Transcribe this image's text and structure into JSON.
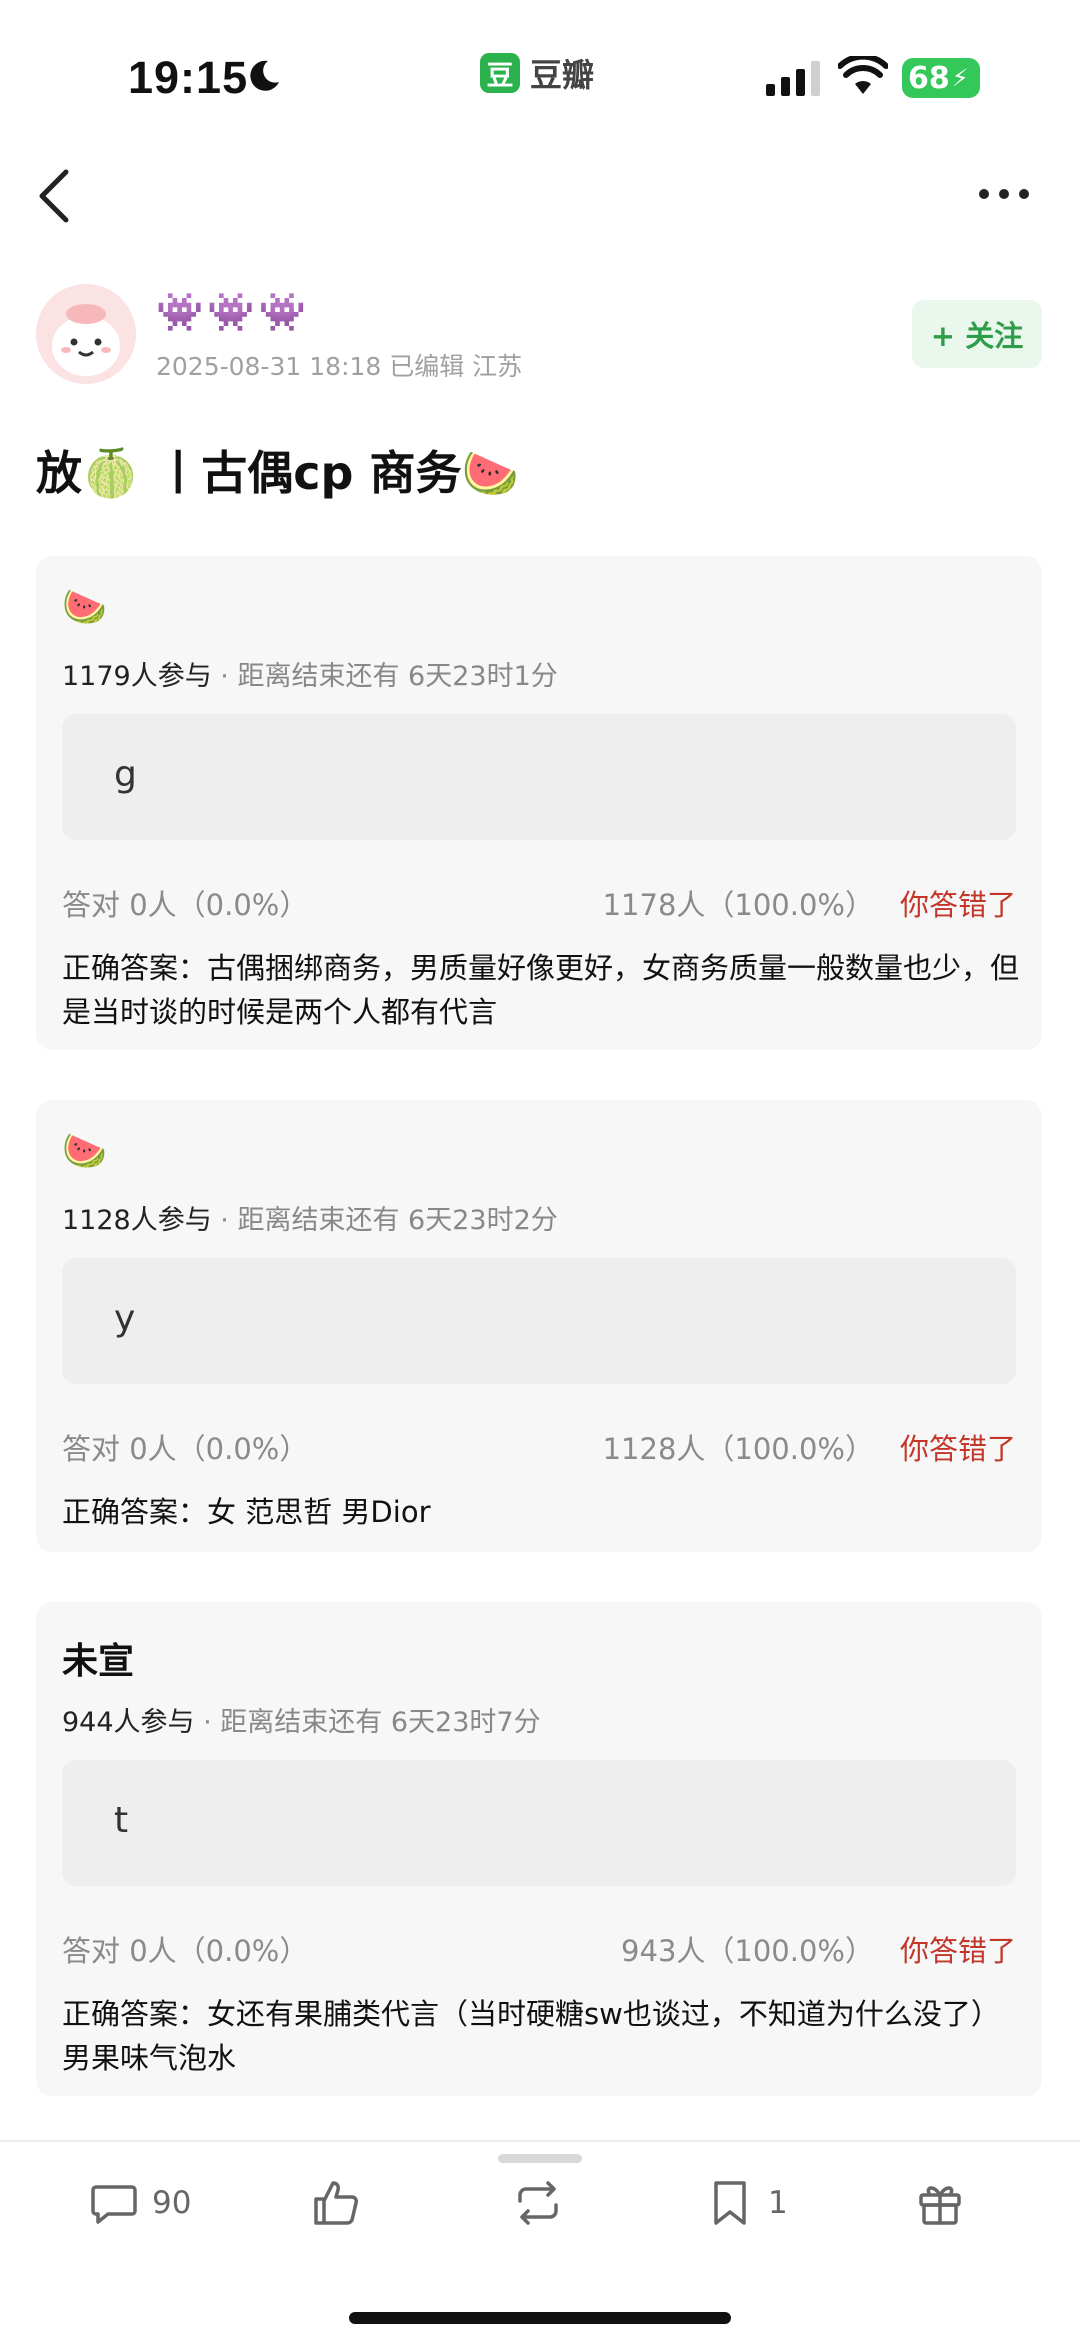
{
  "status_bar": {
    "time": "19:15",
    "app_name": "豆瓣",
    "app_logo_text": "豆",
    "battery": "68"
  },
  "post": {
    "author_name": "👾👾👾",
    "meta": "2025-08-31 18:18  已编辑  江苏",
    "follow_label": "+ 关注",
    "title": "放🍈 丨古偶cp 商务🍉"
  },
  "polls": [
    {
      "title": "🍉",
      "participants": "1179人参与",
      "deadline": "距离结束还有 6天23时1分",
      "option": "g",
      "correct_result": "答对  0人（0.0%）",
      "wrong_result": "1178人（100.0%）",
      "verdict": "你答错了",
      "answer": "正确答案：古偶捆绑商务，男质量好像更好，女商务质量一般数量也少，但是当时谈的时候是两个人都有代言"
    },
    {
      "title": "🍉",
      "participants": "1128人参与",
      "deadline": "距离结束还有 6天23时2分",
      "option": "y",
      "correct_result": "答对  0人（0.0%）",
      "wrong_result": "1128人（100.0%）",
      "verdict": "你答错了",
      "answer": "正确答案：女 范思哲 男Dior"
    },
    {
      "title": "未宣",
      "participants": "944人参与",
      "deadline": "距离结束还有 6天23时7分",
      "option": "t",
      "correct_result": "答对  0人（0.0%）",
      "wrong_result": "943人（100.0%）",
      "verdict": "你答错了",
      "answer": "正确答案：女还有果脯类代言（当时硬糖sw也谈过，不知道为什么没了） 男果味气泡水"
    }
  ],
  "bottom_bar": {
    "comment_count": "90",
    "collect_count": "1"
  },
  "colors": {
    "brand_green": "#2bb24c",
    "wrong_red": "#c2372a",
    "card_bg": "#f7f7f7"
  },
  "icons": [
    "moon-icon",
    "signal-icon",
    "wifi-icon",
    "back-icon",
    "more-icon",
    "comment-icon",
    "like-icon",
    "repost-icon",
    "collect-icon",
    "gift-icon"
  ]
}
